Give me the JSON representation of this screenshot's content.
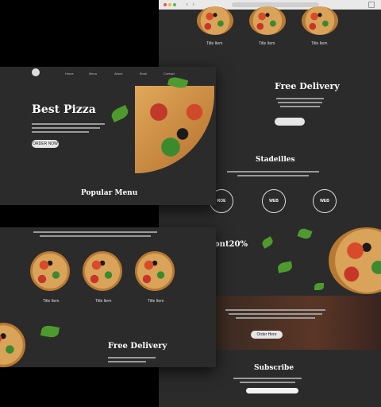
{
  "browser": {
    "url": ""
  },
  "back_panel": {
    "free_delivery": "Free Delivery",
    "specialties": "Stadeilles",
    "rings": [
      "ROE",
      "WEB",
      "WEB"
    ],
    "discount": "ont20%",
    "buy_button": "Order Here",
    "subscribe": "Subscribe",
    "product_names": [
      "Title Item",
      "Title Item",
      "Title Item"
    ]
  },
  "hero_panel": {
    "nav": [
      "Home",
      "Menu",
      "About",
      "Book",
      "Contact"
    ],
    "title": "Best Pizza",
    "cta": "ORDER NOW",
    "popular": "Popular Menu"
  },
  "menu_panel": {
    "items": [
      "Title Item",
      "Title Item",
      "Title Item"
    ],
    "free_delivery": "Free Delivery"
  }
}
